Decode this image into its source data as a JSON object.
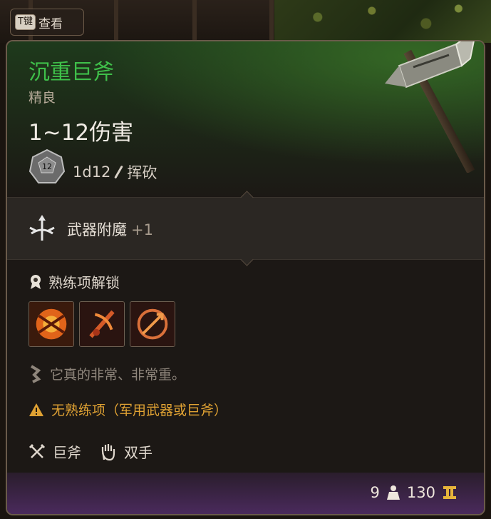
{
  "key_hint": {
    "key": "T键",
    "label": "查看"
  },
  "item": {
    "name": "沉重巨斧",
    "rarity": "精良",
    "damage": "1~12伤害",
    "dice_number": "12",
    "dice": "1d12",
    "damage_type": "挥砍",
    "colors": {
      "name": "#3fbf4a",
      "warning": "#e0a233"
    }
  },
  "enchant": {
    "label": "武器附魔",
    "bonus": "+1"
  },
  "proficiency": {
    "title": "熟练项解锁",
    "skills": [
      "skill-icon-1",
      "skill-icon-2",
      "skill-icon-3"
    ]
  },
  "flavor_text": "它真的非常、非常重。",
  "warning": "无熟练项（军用武器或巨斧）",
  "properties": [
    {
      "icon": "crossed-axes-icon",
      "label": "巨斧"
    },
    {
      "icon": "hand-icon",
      "label": "双手"
    }
  ],
  "footer": {
    "weight": "9",
    "value": "130"
  }
}
